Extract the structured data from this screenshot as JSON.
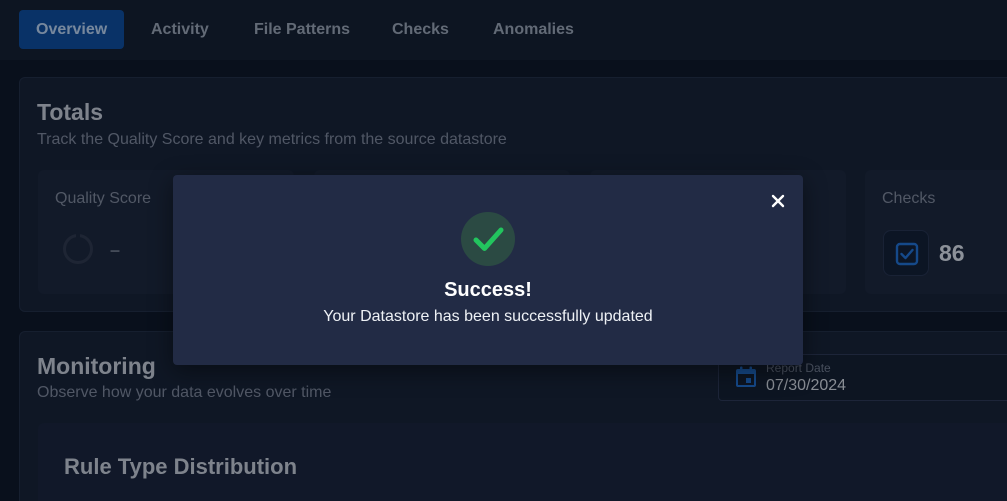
{
  "tabs": [
    {
      "label": "Overview",
      "active": true
    },
    {
      "label": "Activity",
      "active": false
    },
    {
      "label": "File Patterns",
      "active": false
    },
    {
      "label": "Checks",
      "active": false
    },
    {
      "label": "Anomalies",
      "active": false
    }
  ],
  "totals": {
    "title": "Totals",
    "subtitle": "Track the Quality Score and key metrics from the source datastore",
    "metrics": [
      {
        "label": "Quality Score",
        "value": "–",
        "icon": "quality-score-ring-icon"
      },
      {
        "label": "Checks",
        "value": "86",
        "icon": "checks-icon"
      }
    ]
  },
  "monitoring": {
    "title": "Monitoring",
    "subtitle": "Observe how your data evolves over time",
    "report_date": {
      "label": "Report Date",
      "value": "07/30/2024",
      "icon": "calendar-icon"
    },
    "section_title": "Rule Type Distribution"
  },
  "modal": {
    "title": "Success!",
    "message": "Your Datastore has been successfully updated",
    "icon": "success-check-icon",
    "close_icon": "close-icon"
  },
  "colors": {
    "accent": "#0a4a9a",
    "success": "#22c55e",
    "background": "#0b1221"
  }
}
